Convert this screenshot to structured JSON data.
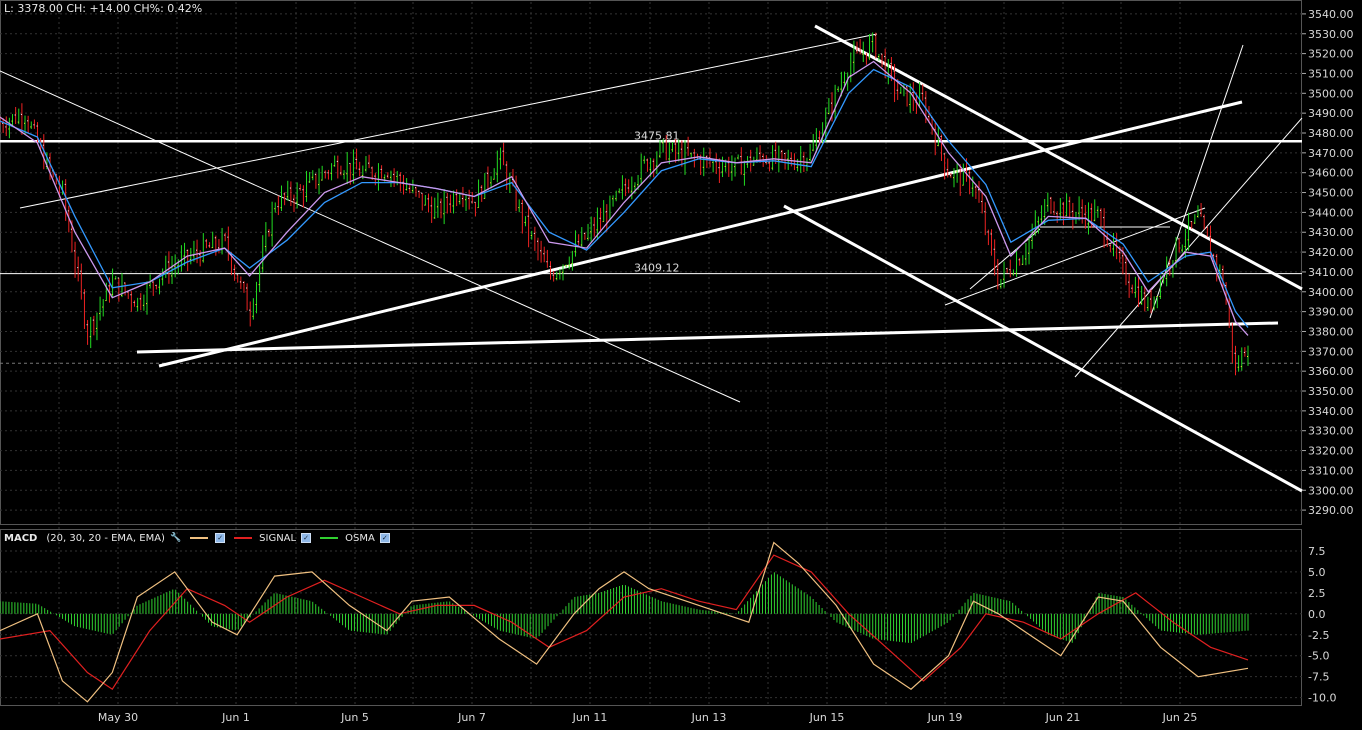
{
  "readout": "L: 3378.00 CH: +14.00 CH%: 0.42%",
  "macd_legend": {
    "title": "MACD",
    "params": "(20, 30, 20 - EMA, EMA)",
    "signal_label": "SIGNAL",
    "osma_label": "OSMA",
    "macd_color": "#f0c080",
    "signal_color": "#e02020",
    "osma_color": "#30d030"
  },
  "chart_data": [
    {
      "type": "candlestick",
      "title": "",
      "x_tick_labels": [
        "May 30",
        "Jun 1",
        "Jun 5",
        "Jun 7",
        "Jun 11",
        "Jun 13",
        "Jun 15",
        "Jun 19",
        "Jun 21",
        "Jun 25"
      ],
      "y_ticks": [
        3290,
        3300,
        3310,
        3320,
        3330,
        3340,
        3350,
        3360,
        3370,
        3380,
        3390,
        3400,
        3410,
        3420,
        3430,
        3440,
        3450,
        3460,
        3470,
        3480,
        3490,
        3500,
        3510,
        3520,
        3530,
        3540
      ],
      "ylim": [
        3283,
        3546
      ],
      "last": 3378,
      "price_labels": [
        {
          "text": "3475.81",
          "value": 3475.81
        },
        {
          "text": "3409.12",
          "value": 3409.12
        }
      ],
      "price_path": [
        [
          0,
          3485
        ],
        [
          0.02,
          3490
        ],
        [
          0.04,
          3460
        ],
        [
          0.05,
          3450
        ],
        [
          0.07,
          3380
        ],
        [
          0.09,
          3405
        ],
        [
          0.11,
          3395
        ],
        [
          0.13,
          3410
        ],
        [
          0.16,
          3420
        ],
        [
          0.18,
          3425
        ],
        [
          0.2,
          3390
        ],
        [
          0.22,
          3445
        ],
        [
          0.24,
          3450
        ],
        [
          0.27,
          3465
        ],
        [
          0.29,
          3460
        ],
        [
          0.31,
          3462
        ],
        [
          0.33,
          3450
        ],
        [
          0.35,
          3440
        ],
        [
          0.37,
          3452
        ],
        [
          0.38,
          3445
        ],
        [
          0.4,
          3468
        ],
        [
          0.42,
          3435
        ],
        [
          0.44,
          3408
        ],
        [
          0.45,
          3414
        ],
        [
          0.47,
          3428
        ],
        [
          0.49,
          3443
        ],
        [
          0.51,
          3460
        ],
        [
          0.53,
          3472
        ],
        [
          0.55,
          3468
        ],
        [
          0.57,
          3465
        ],
        [
          0.59,
          3463
        ],
        [
          0.61,
          3468
        ],
        [
          0.63,
          3465
        ],
        [
          0.65,
          3470
        ],
        [
          0.68,
          3515
        ],
        [
          0.7,
          3525
        ],
        [
          0.72,
          3500
        ],
        [
          0.74,
          3495
        ],
        [
          0.76,
          3460
        ],
        [
          0.78,
          3455
        ],
        [
          0.8,
          3405
        ],
        [
          0.82,
          3420
        ],
        [
          0.84,
          3445
        ],
        [
          0.86,
          3440
        ],
        [
          0.88,
          3438
        ],
        [
          0.9,
          3410
        ],
        [
          0.92,
          3392
        ],
        [
          0.94,
          3420
        ],
        [
          0.96,
          3437
        ],
        [
          0.98,
          3405
        ],
        [
          0.99,
          3360
        ],
        [
          1,
          3375
        ]
      ],
      "ema_fast": [
        [
          0,
          3488
        ],
        [
          0.03,
          3475
        ],
        [
          0.06,
          3430
        ],
        [
          0.09,
          3397
        ],
        [
          0.12,
          3405
        ],
        [
          0.15,
          3418
        ],
        [
          0.18,
          3422
        ],
        [
          0.2,
          3408
        ],
        [
          0.23,
          3430
        ],
        [
          0.26,
          3450
        ],
        [
          0.29,
          3458
        ],
        [
          0.32,
          3455
        ],
        [
          0.35,
          3452
        ],
        [
          0.38,
          3448
        ],
        [
          0.41,
          3458
        ],
        [
          0.44,
          3425
        ],
        [
          0.47,
          3422
        ],
        [
          0.5,
          3445
        ],
        [
          0.53,
          3465
        ],
        [
          0.56,
          3468
        ],
        [
          0.59,
          3465
        ],
        [
          0.62,
          3467
        ],
        [
          0.65,
          3465
        ],
        [
          0.68,
          3508
        ],
        [
          0.7,
          3516
        ],
        [
          0.73,
          3500
        ],
        [
          0.76,
          3470
        ],
        [
          0.79,
          3448
        ],
        [
          0.81,
          3418
        ],
        [
          0.84,
          3438
        ],
        [
          0.87,
          3437
        ],
        [
          0.9,
          3420
        ],
        [
          0.92,
          3400
        ],
        [
          0.95,
          3420
        ],
        [
          0.97,
          3418
        ],
        [
          0.99,
          3385
        ],
        [
          1,
          3378
        ]
      ],
      "ema_slow": [
        [
          0,
          3486
        ],
        [
          0.03,
          3478
        ],
        [
          0.06,
          3438
        ],
        [
          0.09,
          3402
        ],
        [
          0.12,
          3405
        ],
        [
          0.15,
          3415
        ],
        [
          0.18,
          3422
        ],
        [
          0.2,
          3412
        ],
        [
          0.23,
          3426
        ],
        [
          0.26,
          3445
        ],
        [
          0.29,
          3455
        ],
        [
          0.32,
          3455
        ],
        [
          0.35,
          3452
        ],
        [
          0.38,
          3448
        ],
        [
          0.41,
          3455
        ],
        [
          0.44,
          3430
        ],
        [
          0.47,
          3421
        ],
        [
          0.5,
          3440
        ],
        [
          0.53,
          3461
        ],
        [
          0.56,
          3467
        ],
        [
          0.59,
          3465
        ],
        [
          0.62,
          3466
        ],
        [
          0.65,
          3463
        ],
        [
          0.68,
          3500
        ],
        [
          0.7,
          3512
        ],
        [
          0.73,
          3503
        ],
        [
          0.76,
          3476
        ],
        [
          0.79,
          3454
        ],
        [
          0.81,
          3425
        ],
        [
          0.84,
          3436
        ],
        [
          0.87,
          3437
        ],
        [
          0.9,
          3424
        ],
        [
          0.92,
          3405
        ],
        [
          0.95,
          3418
        ],
        [
          0.97,
          3420
        ],
        [
          0.99,
          3390
        ],
        [
          1,
          3382
        ]
      ],
      "drawn_lines_by_value": [
        {
          "kind": "horizontal",
          "value": 3475.81
        },
        {
          "kind": "horizontal",
          "value": 3409.12
        },
        {
          "kind": "horizontal-dashed",
          "value": 3364
        }
      ]
    },
    {
      "type": "macd",
      "title": "",
      "y_ticks": [
        7.5,
        5.0,
        2.5,
        0.0,
        -2.5,
        -5.0,
        -7.5,
        -10.0
      ],
      "y_tick_labels": [
        "7.5",
        "5.0",
        "2.5",
        "0.0",
        "-2.5",
        "-5.0",
        "-7.5",
        "-10.0"
      ],
      "ylim": [
        -11,
        10
      ],
      "macd": [
        [
          0,
          -2
        ],
        [
          0.03,
          0
        ],
        [
          0.05,
          -8
        ],
        [
          0.07,
          -10.5
        ],
        [
          0.09,
          -7
        ],
        [
          0.11,
          2
        ],
        [
          0.14,
          5
        ],
        [
          0.17,
          -1
        ],
        [
          0.19,
          -2.5
        ],
        [
          0.22,
          4.5
        ],
        [
          0.25,
          5
        ],
        [
          0.28,
          1
        ],
        [
          0.31,
          -2
        ],
        [
          0.33,
          1.5
        ],
        [
          0.36,
          2
        ],
        [
          0.4,
          -3
        ],
        [
          0.43,
          -6
        ],
        [
          0.46,
          0
        ],
        [
          0.48,
          3
        ],
        [
          0.5,
          5
        ],
        [
          0.52,
          3
        ],
        [
          0.55,
          1.5
        ],
        [
          0.58,
          0
        ],
        [
          0.6,
          -1
        ],
        [
          0.62,
          8.5
        ],
        [
          0.64,
          6
        ],
        [
          0.67,
          1
        ],
        [
          0.7,
          -6
        ],
        [
          0.73,
          -9
        ],
        [
          0.76,
          -5
        ],
        [
          0.78,
          1.5
        ],
        [
          0.8,
          0
        ],
        [
          0.83,
          -3
        ],
        [
          0.85,
          -5
        ],
        [
          0.88,
          2
        ],
        [
          0.9,
          1.5
        ],
        [
          0.93,
          -4
        ],
        [
          0.96,
          -7.5
        ],
        [
          1,
          -6.5
        ]
      ],
      "signal": [
        [
          0,
          -3
        ],
        [
          0.04,
          -2
        ],
        [
          0.07,
          -7
        ],
        [
          0.09,
          -9
        ],
        [
          0.12,
          -2
        ],
        [
          0.15,
          3
        ],
        [
          0.18,
          1
        ],
        [
          0.2,
          -1
        ],
        [
          0.23,
          2
        ],
        [
          0.26,
          4
        ],
        [
          0.29,
          2
        ],
        [
          0.32,
          0
        ],
        [
          0.35,
          1
        ],
        [
          0.38,
          1
        ],
        [
          0.41,
          -1
        ],
        [
          0.44,
          -4
        ],
        [
          0.47,
          -2
        ],
        [
          0.5,
          2
        ],
        [
          0.53,
          3
        ],
        [
          0.56,
          1.5
        ],
        [
          0.59,
          0.5
        ],
        [
          0.62,
          7
        ],
        [
          0.65,
          5
        ],
        [
          0.68,
          0
        ],
        [
          0.71,
          -4
        ],
        [
          0.74,
          -8
        ],
        [
          0.77,
          -4
        ],
        [
          0.79,
          0
        ],
        [
          0.82,
          -1
        ],
        [
          0.85,
          -3
        ],
        [
          0.88,
          0
        ],
        [
          0.91,
          2.5
        ],
        [
          0.94,
          -1
        ],
        [
          0.97,
          -4
        ],
        [
          1,
          -5.5
        ]
      ],
      "osma": [
        [
          0,
          1.5
        ],
        [
          0.03,
          1.2
        ],
        [
          0.06,
          -1.5
        ],
        [
          0.09,
          -2.5
        ],
        [
          0.11,
          1
        ],
        [
          0.14,
          3
        ],
        [
          0.17,
          -1.5
        ],
        [
          0.19,
          -2
        ],
        [
          0.22,
          2.5
        ],
        [
          0.25,
          1.5
        ],
        [
          0.28,
          -2
        ],
        [
          0.31,
          -2.5
        ],
        [
          0.33,
          1
        ],
        [
          0.36,
          1.5
        ],
        [
          0.4,
          -2
        ],
        [
          0.43,
          -3
        ],
        [
          0.46,
          2
        ],
        [
          0.48,
          2.5
        ],
        [
          0.5,
          3.5
        ],
        [
          0.53,
          1.5
        ],
        [
          0.56,
          0.5
        ],
        [
          0.59,
          0
        ],
        [
          0.62,
          5
        ],
        [
          0.65,
          2
        ],
        [
          0.67,
          -1
        ],
        [
          0.7,
          -3
        ],
        [
          0.73,
          -3.5
        ],
        [
          0.76,
          -1
        ],
        [
          0.78,
          2.5
        ],
        [
          0.81,
          1.5
        ],
        [
          0.84,
          -2.5
        ],
        [
          0.86,
          -3.5
        ],
        [
          0.88,
          2.5
        ],
        [
          0.9,
          2
        ],
        [
          0.93,
          -2
        ],
        [
          0.96,
          -2.5
        ],
        [
          1,
          -2
        ]
      ]
    }
  ]
}
